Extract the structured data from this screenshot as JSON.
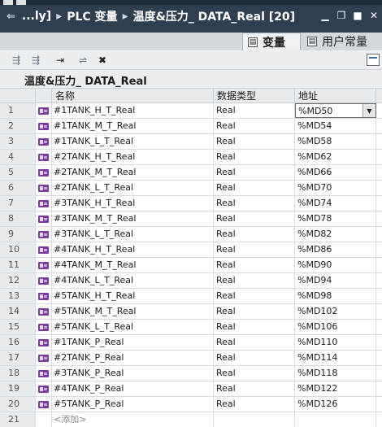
{
  "titlebar": {
    "path_start": "...ly]",
    "path_middle": "PLC 变量",
    "path_end": "温度&压力_ DATA_Real [20]"
  },
  "tabs": [
    {
      "label": "变量",
      "active": true
    },
    {
      "label": "用户常量",
      "active": false
    }
  ],
  "table_title": "温度&压力_ DATA_Real",
  "columns": {
    "name": "名称",
    "type": "数据类型",
    "address": "地址"
  },
  "rows": [
    {
      "num": "1",
      "name": "#1TANK_H_T_Real",
      "type": "Real",
      "address": "%MD50"
    },
    {
      "num": "2",
      "name": "#1TANK_M_T_Real",
      "type": "Real",
      "address": "%MD54"
    },
    {
      "num": "3",
      "name": "#1TANK_L_T_Real",
      "type": "Real",
      "address": "%MD58"
    },
    {
      "num": "4",
      "name": "#2TANK_H_T_Real",
      "type": "Real",
      "address": "%MD62"
    },
    {
      "num": "5",
      "name": "#2TANK_M_T_Real",
      "type": "Real",
      "address": "%MD66"
    },
    {
      "num": "6",
      "name": "#2TANK_L_T_Real",
      "type": "Real",
      "address": "%MD70"
    },
    {
      "num": "7",
      "name": "#3TANK_H_T_Real",
      "type": "Real",
      "address": "%MD74"
    },
    {
      "num": "8",
      "name": "#3TANK_M_T_Real",
      "type": "Real",
      "address": "%MD78"
    },
    {
      "num": "9",
      "name": "#3TANK_L_T_Real",
      "type": "Real",
      "address": "%MD82"
    },
    {
      "num": "10",
      "name": "#4TANK_H_T_Real",
      "type": "Real",
      "address": "%MD86"
    },
    {
      "num": "11",
      "name": "#4TANK_M_T_Real",
      "type": "Real",
      "address": "%MD90"
    },
    {
      "num": "12",
      "name": "#4TANK_L_T_Real",
      "type": "Real",
      "address": "%MD94"
    },
    {
      "num": "13",
      "name": "#5TANK_H_T_Real",
      "type": "Real",
      "address": "%MD98"
    },
    {
      "num": "14",
      "name": "#5TANK_M_T_Real",
      "type": "Real",
      "address": "%MD102"
    },
    {
      "num": "15",
      "name": "#5TANK_L_T_Real",
      "type": "Real",
      "address": "%MD106"
    },
    {
      "num": "16",
      "name": "#1TANK_P_Real",
      "type": "Real",
      "address": "%MD110"
    },
    {
      "num": "17",
      "name": "#2TANK_P_Real",
      "type": "Real",
      "address": "%MD114"
    },
    {
      "num": "18",
      "name": "#3TANK_P_Real",
      "type": "Real",
      "address": "%MD118"
    },
    {
      "num": "19",
      "name": "#4TANK_P_Real",
      "type": "Real",
      "address": "%MD122"
    },
    {
      "num": "20",
      "name": "#5TANK_P_Real",
      "type": "Real",
      "address": "%MD126"
    }
  ],
  "add_row": {
    "num": "21",
    "label": "<添加>"
  },
  "colors": {
    "titlebar": "#2f3f4f",
    "tag_icon": "#7a3aa0"
  }
}
